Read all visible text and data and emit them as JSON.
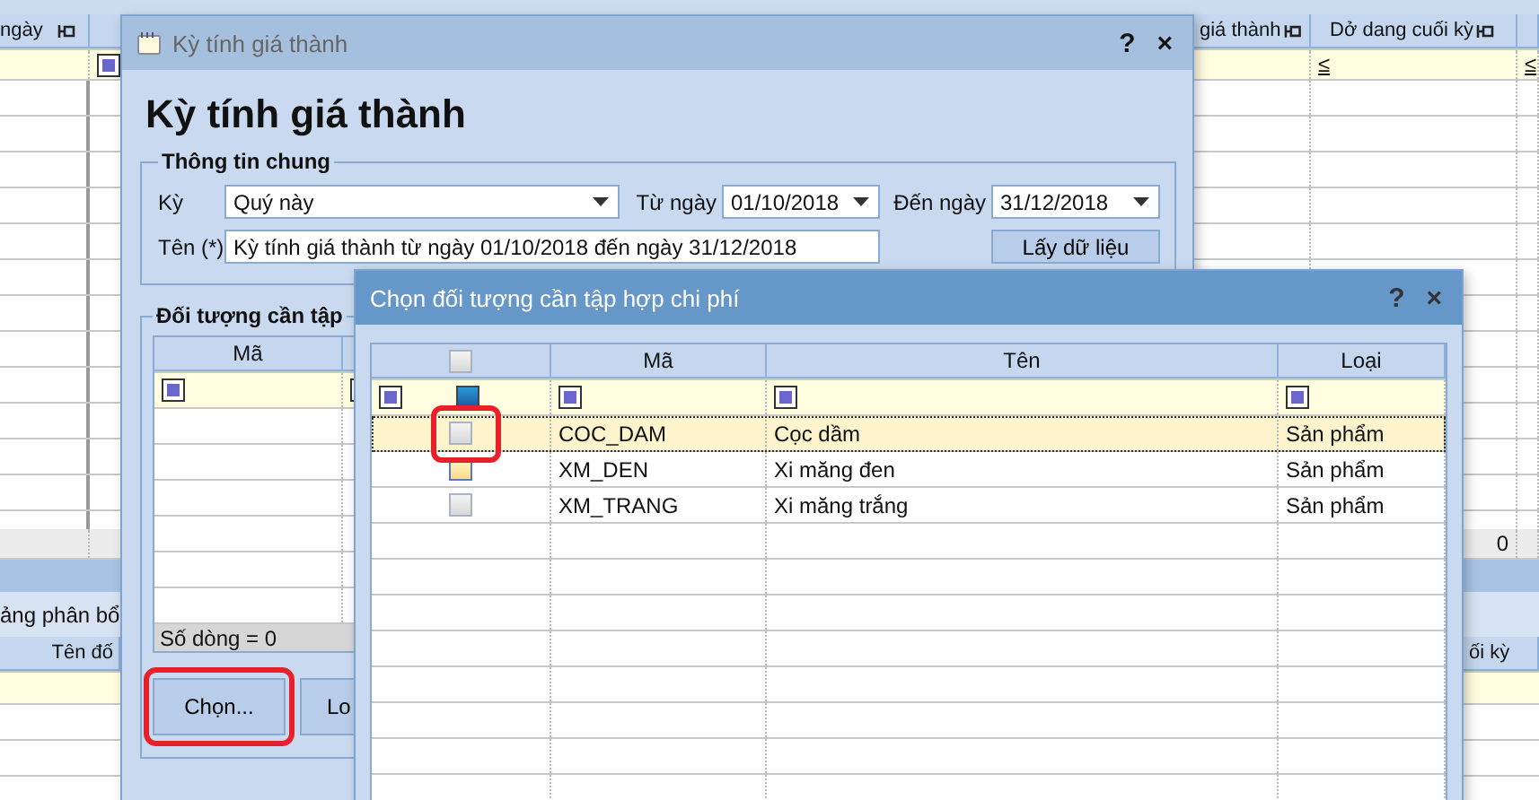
{
  "main_grid": {
    "columns": [
      {
        "header": "ngày"
      },
      {
        "filter": {
          "kind": "icon"
        }
      },
      {
        "header": "giá thành"
      },
      {
        "header": "Dở dang cuối kỳ",
        "filter": {
          "kind": "operator",
          "text": "≤"
        },
        "total": "0"
      },
      {
        "filter": {
          "kind": "operator",
          "text": "≤"
        }
      }
    ]
  },
  "lower_panel": {
    "tab": "ảng phân bổ",
    "columns": [
      {
        "header": "Tên đố"
      },
      {
        "header": "ối kỳ"
      }
    ]
  },
  "period_dialog": {
    "title": "Kỳ tính giá thành",
    "help": "?",
    "close": "×",
    "heading": "Kỳ tính giá thành",
    "general": {
      "legend": "Thông tin chung",
      "period_label": "Kỳ",
      "period": "Quý này",
      "from_label": "Từ ngày",
      "from": "01/10/2018",
      "to_label": "Đến ngày",
      "to": "31/12/2018",
      "name_label": "Tên (*)",
      "name": "Kỳ tính giá thành từ ngày 01/10/2018 đến ngày 31/12/2018",
      "fetch_button": "Lấy dữ liệu"
    },
    "objects": {
      "legend": "Đối tượng cần tập",
      "columns": [
        "Mã"
      ],
      "footer": "Số dòng = 0"
    },
    "buttons": [
      {
        "label": "Chọn...",
        "highlighted": true
      },
      {
        "label": "Lo",
        "highlighted": false
      }
    ]
  },
  "select_dialog": {
    "title": "Chọn đối tượng cần tập hợp chi phí",
    "help": "?",
    "close": "×",
    "header_check": {
      "checked": false
    },
    "columns": [
      "Mã",
      "Tên",
      "Loại"
    ],
    "rows": [
      {
        "code": "COC_DAM",
        "name": "Cọc dầm",
        "type": "Sản phẩm",
        "checked": false,
        "hovered": false,
        "selected": true,
        "highlighted": true
      },
      {
        "code": "XM_DEN",
        "name": "Xi măng đen",
        "type": "Sản phẩm",
        "checked": false,
        "hovered": true,
        "selected": false,
        "highlighted": false
      },
      {
        "code": "XM_TRANG",
        "name": "Xi măng trắng",
        "type": "Sản phẩm",
        "checked": false,
        "hovered": false,
        "selected": false,
        "highlighted": false
      }
    ]
  }
}
